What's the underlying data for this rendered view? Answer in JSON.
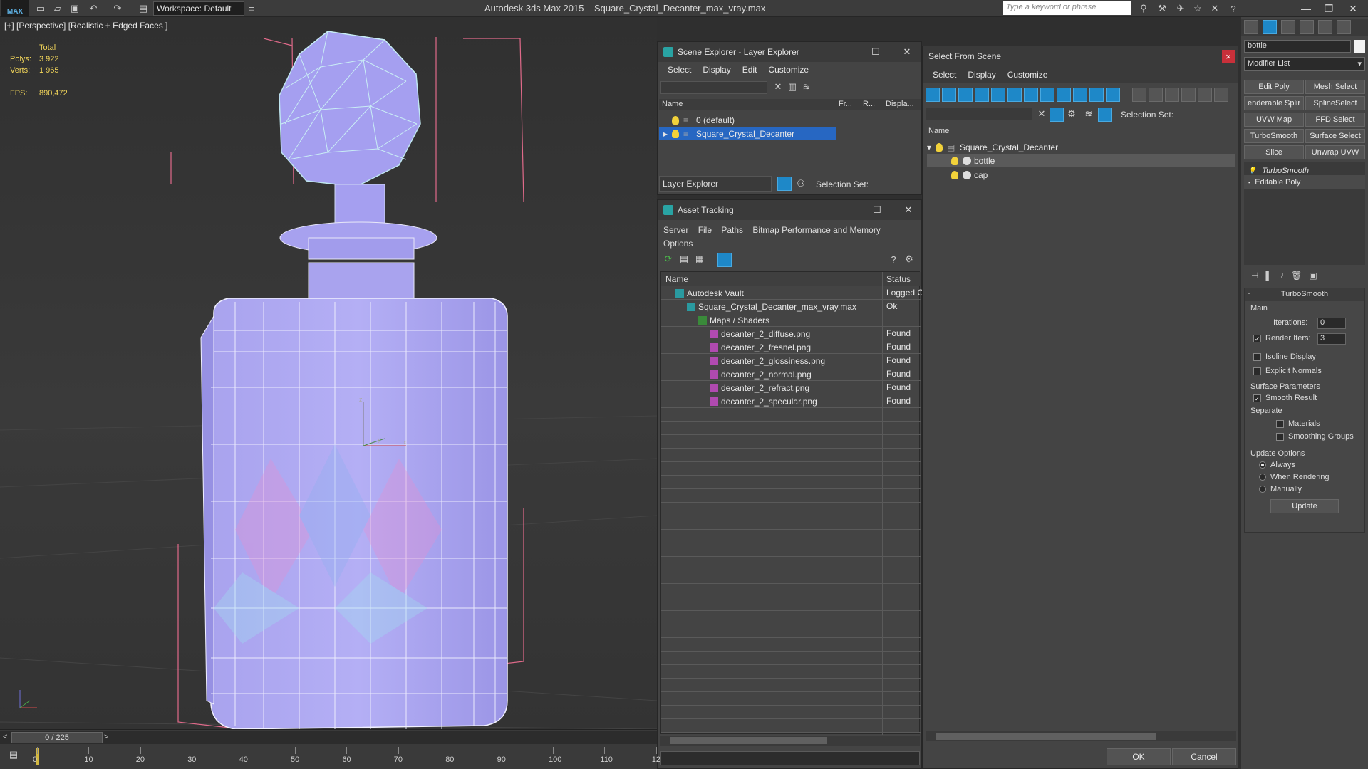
{
  "app": {
    "logo": "MAX",
    "workspace": "Workspace: Default",
    "title": "Autodesk 3ds Max  2015",
    "filename": "Square_Crystal_Decanter_max_vray.max",
    "search_placeholder": "Type a keyword or phrase"
  },
  "viewport": {
    "label": "[+] [Perspective] [Realistic + Edged Faces ]",
    "stats": {
      "total_label": "Total",
      "polys_label": "Polys:",
      "polys_value": "3 922",
      "verts_label": "Verts:",
      "verts_value": "1 965",
      "fps_label": "FPS:",
      "fps_value": "890,472"
    }
  },
  "scene_explorer": {
    "title": "Scene Explorer - Layer Explorer",
    "menu": [
      "Select",
      "Display",
      "Edit",
      "Customize"
    ],
    "columns": [
      "Name",
      "Fr...",
      "R...",
      "Displa..."
    ],
    "layers": [
      "0 (default)",
      "Square_Crystal_Decanter"
    ],
    "footer_dropdown": "Layer Explorer",
    "selection_set_label": "Selection Set:"
  },
  "asset_tracking": {
    "title": "Asset Tracking",
    "menu": [
      "Server",
      "File",
      "Paths",
      "Bitmap Performance and Memory",
      "Options"
    ],
    "columns": [
      "Name",
      "Status"
    ],
    "rows": [
      {
        "name": "Autodesk Vault",
        "status": "Logged C"
      },
      {
        "name": "Square_Crystal_Decanter_max_vray.max",
        "status": "Ok"
      },
      {
        "name": "Maps / Shaders",
        "status": ""
      },
      {
        "name": "decanter_2_diffuse.png",
        "status": "Found"
      },
      {
        "name": "decanter_2_fresnel.png",
        "status": "Found"
      },
      {
        "name": "decanter_2_glossiness.png",
        "status": "Found"
      },
      {
        "name": "decanter_2_normal.png",
        "status": "Found"
      },
      {
        "name": "decanter_2_refract.png",
        "status": "Found"
      },
      {
        "name": "decanter_2_specular.png",
        "status": "Found"
      }
    ]
  },
  "select_from_scene": {
    "title": "Select From Scene",
    "menu": [
      "Select",
      "Display",
      "Customize"
    ],
    "selection_set_label": "Selection Set:",
    "column_name": "Name",
    "tree": [
      "Square_Crystal_Decanter",
      "bottle",
      "cap"
    ],
    "ok": "OK",
    "cancel": "Cancel"
  },
  "command_panel": {
    "object_name": "bottle",
    "modifier_list": "Modifier List",
    "buttons": [
      "Edit Poly",
      "Mesh Select",
      "enderable Splir",
      "SplineSelect",
      "UVW Map",
      "FFD Select",
      "TurboSmooth",
      "Surface Select",
      "Slice",
      "Unwrap UVW"
    ],
    "stack": [
      "TurboSmooth",
      "Editable Poly"
    ],
    "rollout_title": "TurboSmooth",
    "main_label": "Main",
    "iterations_label": "Iterations:",
    "iterations_value": "0",
    "render_iters_label": "Render Iters:",
    "render_iters_value": "3",
    "isoline_label": "Isoline Display",
    "explicit_normals_label": "Explicit Normals",
    "surface_params_label": "Surface Parameters",
    "smooth_result_label": "Smooth Result",
    "separate_label": "Separate",
    "materials_label": "Materials",
    "smoothing_groups_label": "Smoothing Groups",
    "update_options_label": "Update Options",
    "always_label": "Always",
    "when_rendering_label": "When Rendering",
    "manually_label": "Manually",
    "update_button": "Update"
  },
  "timeline": {
    "frame": "0 / 225",
    "ticks": [
      "0",
      "10",
      "20",
      "30",
      "40",
      "50",
      "60",
      "70",
      "80",
      "90",
      "100",
      "110",
      "12"
    ]
  }
}
